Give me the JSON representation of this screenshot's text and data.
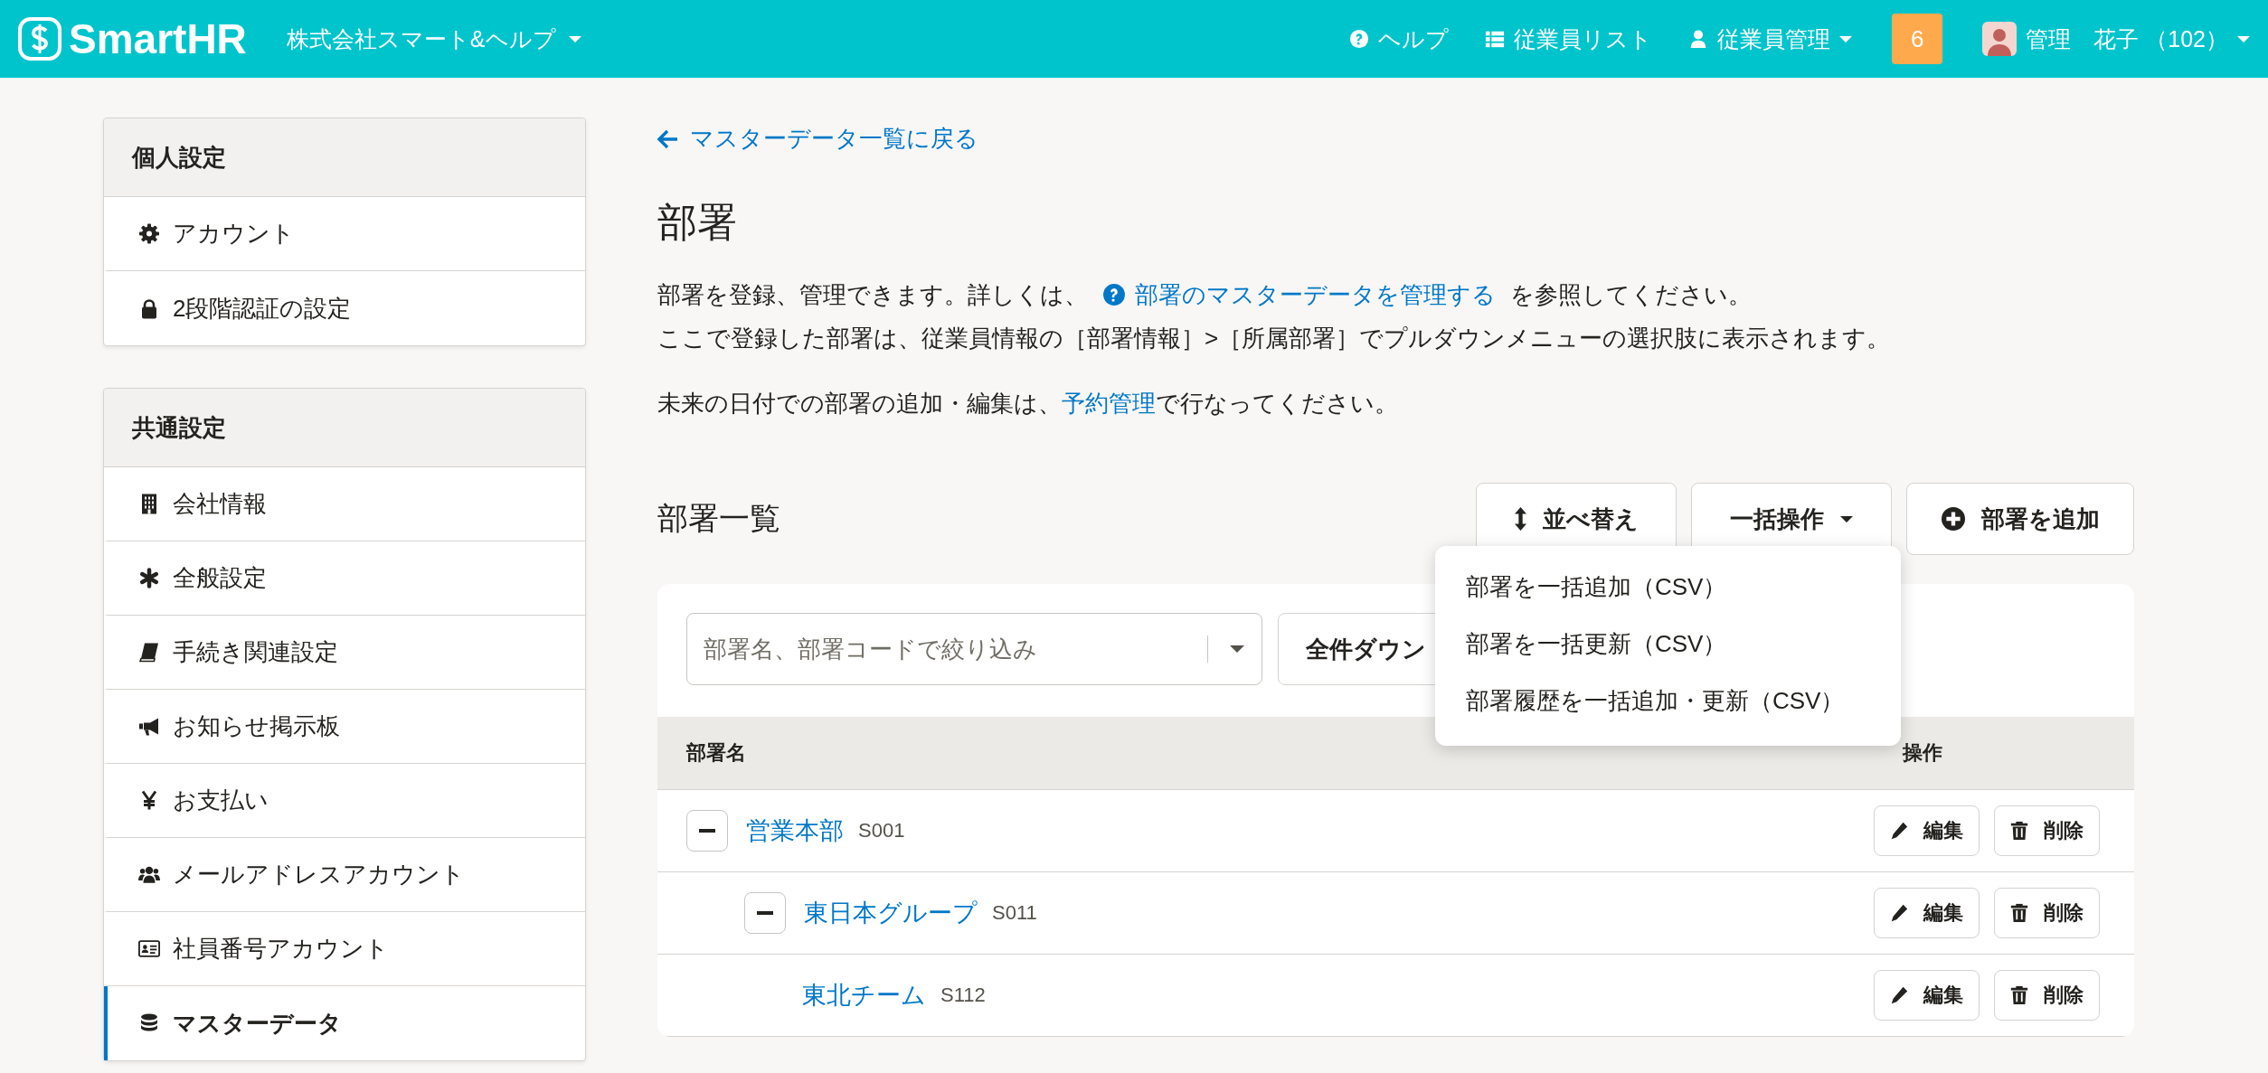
{
  "header": {
    "logo": "SmartHR",
    "company": "株式会社スマート&ヘルプ",
    "nav": [
      {
        "kind": "help",
        "label": "ヘルプ"
      },
      {
        "kind": "list",
        "label": "従業員リスト"
      },
      {
        "kind": "user",
        "label": "従業員管理"
      }
    ],
    "notification_count": "6",
    "user_name": "管理　花子 （102）"
  },
  "sidebar": [
    {
      "title": "個人設定",
      "items": [
        {
          "label": "アカウント",
          "selected": false
        },
        {
          "label": "2段階認証の設定",
          "selected": false
        }
      ]
    },
    {
      "title": "共通設定",
      "items": [
        {
          "label": "会社情報",
          "selected": false
        },
        {
          "label": "全般設定",
          "selected": false
        },
        {
          "label": "手続き関連設定",
          "selected": false
        },
        {
          "label": "お知らせ掲示板",
          "selected": false
        },
        {
          "label": "お支払い",
          "selected": false
        },
        {
          "label": "メールアドレスアカウント",
          "selected": false
        },
        {
          "label": "社員番号アカウント",
          "selected": false
        },
        {
          "label": "マスターデータ",
          "selected": true
        }
      ]
    }
  ],
  "back_link": "マスターデータ一覧に戻る",
  "title": "部署",
  "description": [
    {
      "before": "部署を登録、管理できます。詳しくは、",
      "link": "部署のマスターデータを管理する",
      "after": "を参照してください。"
    },
    {
      "before": "ここで登録した部署は、従業員情報の［部署情報］>［所属部署］でプルダウンメニューの選択肢に表示されます。"
    }
  ],
  "note": {
    "before": "未来の日付での部署の追加・編集は、",
    "link": "予約管理",
    "after": "で行なってください。"
  },
  "section_title": "部署一覧",
  "toolbar": [
    {
      "kind": "sort",
      "label": "並べ替え"
    },
    {
      "kind": "bulk",
      "label": "一括操作"
    },
    {
      "kind": "add",
      "label": "部署を追加"
    }
  ],
  "bulk_menu": {
    "open": true,
    "items": [
      "部署を一括追加（CSV）",
      "部署を一括更新（CSV）",
      "部署履歴を一括追加・更新（CSV）"
    ]
  },
  "filter": {
    "placeholder": "部署名、部署コードで絞り込み"
  },
  "download_button": "全件ダウン",
  "table": {
    "columns": [
      "部署名",
      "操作"
    ],
    "rows": [
      {
        "name": "営業本部",
        "code": "S001",
        "expanded": true,
        "actions": [
          "編集",
          "削除"
        ],
        "children": [
          {
            "name": "東日本グループ",
            "code": "S011",
            "expanded": true,
            "actions": [
              "編集",
              "削除"
            ],
            "children": [
              {
                "name": "東北チーム",
                "code": "S112",
                "actions": [
                  "編集",
                  "削除"
                ]
              }
            ]
          }
        ]
      }
    ]
  }
}
